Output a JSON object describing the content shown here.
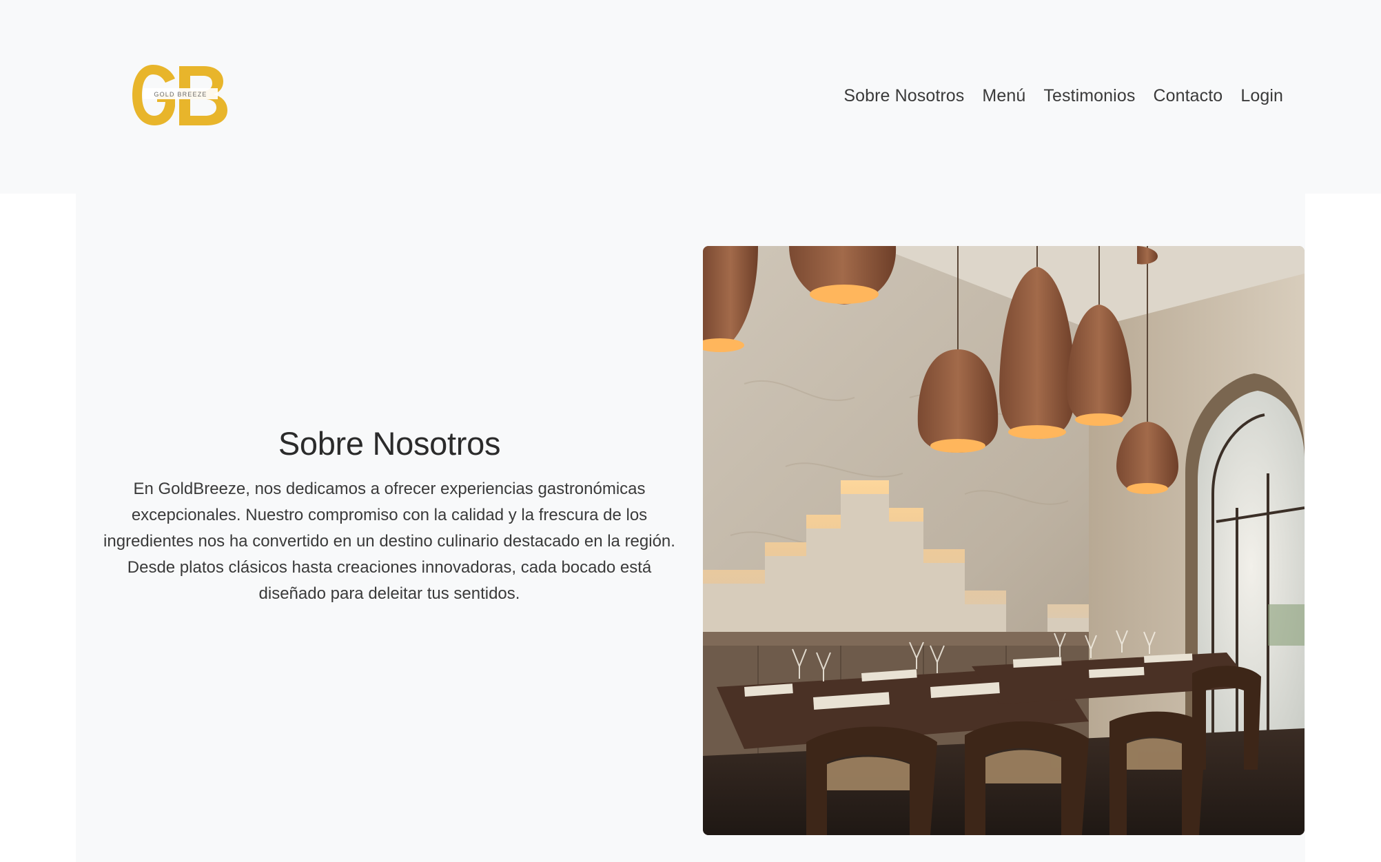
{
  "brand": {
    "logo_text": "GOLD BREEZE",
    "logo_letters": "GB",
    "color": "#e8b52b"
  },
  "nav": {
    "items": [
      {
        "label": "Sobre Nosotros"
      },
      {
        "label": "Menú"
      },
      {
        "label": "Testimonios"
      },
      {
        "label": "Contacto"
      },
      {
        "label": "Login"
      }
    ]
  },
  "about": {
    "title": "Sobre Nosotros",
    "body": "En GoldBreeze, nos dedicamos a ofrecer experiencias gastronómicas excepcionales. Nuestro compromiso con la calidad y la frescura de los ingredientes nos ha convertido en un destino culinario destacado en la región. Desde platos clásicos hasta creaciones innovadoras, cada bocado está diseñado para deleitar tus sentidos."
  },
  "colors": {
    "page_bg": "#f8f9fa",
    "text": "#333333",
    "accent": "#e8b52b"
  }
}
